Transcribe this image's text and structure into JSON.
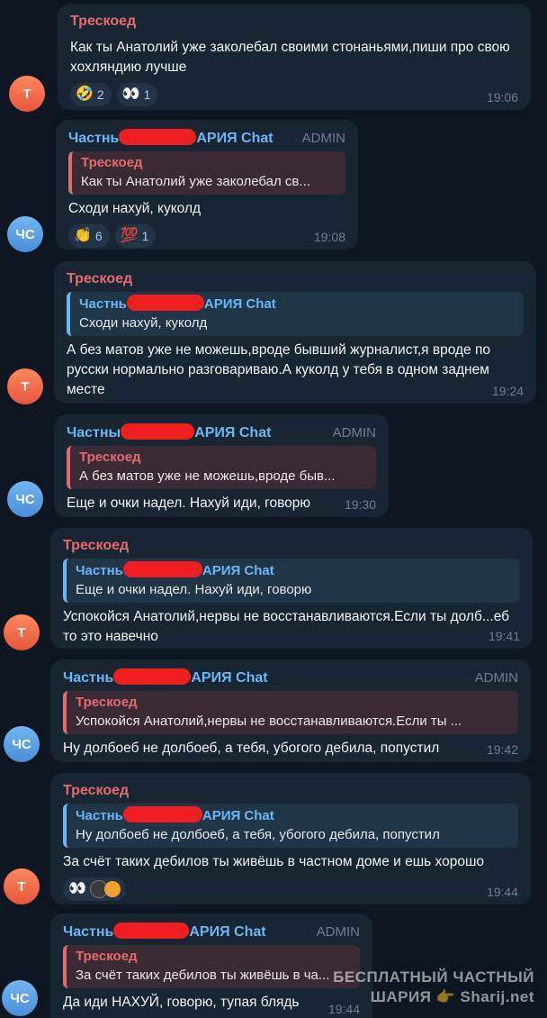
{
  "messages": [
    {
      "sender": "Трескоед",
      "text": "Как ты Анатолий уже заколебал своими стонаньями,пиши про свою хохляндию лучше",
      "time": "19:06",
      "reactions": [
        {
          "emoji": "🤣",
          "count": "2"
        },
        {
          "emoji": "👀",
          "count": "1"
        }
      ],
      "avatar": "Т"
    },
    {
      "sender_pre": "Частнь",
      "sender_post": "АРИЯ Chat",
      "admin": "ADMIN",
      "reply_name": "Трескоед",
      "reply_text": "Как ты Анатолий уже заколебал св...",
      "text": "Сходи нахуй, куколд",
      "time": "19:08",
      "reactions": [
        {
          "emoji": "👏",
          "count": "6"
        },
        {
          "emoji": "💯",
          "count": "1"
        }
      ],
      "avatar": "ЧС"
    },
    {
      "sender": "Трескоед",
      "reply_pre": "Частнь",
      "reply_post": "АРИЯ Chat",
      "reply_text": "Сходи нахуй, куколд",
      "text": "А без матов уже не можешь,вроде бывший журналист,я вроде по русски нормально разговариваю.А куколд у тебя в одном заднем  месте",
      "time": "19:24",
      "avatar": "Т"
    },
    {
      "sender_pre": "Частны",
      "sender_post": "АРИЯ Chat",
      "admin": "ADMIN",
      "reply_name": "Трескоед",
      "reply_text": "А без матов уже не можешь,вроде быв...",
      "text": "Еще и очки надел. Нахуй иди, говорю",
      "time": "19:30",
      "avatar": "ЧС"
    },
    {
      "sender": "Трескоед",
      "reply_pre": "Частнь",
      "reply_post": "АРИЯ Chat",
      "reply_text": "Еще и очки надел. Нахуй иди, говорю",
      "text": "Успокойся Анатолий,нервы не восстанавливаются.Если ты долб...еб то это навечно",
      "time": "19:41",
      "avatar": "Т"
    },
    {
      "sender_pre": "Частнь",
      "sender_post": "АРИЯ Chat",
      "admin": "ADMIN",
      "reply_name": "Трескоед",
      "reply_text": "Успокойся Анатолий,нервы не восстанавливаются.Если ты ...",
      "text": "Ну долбоеб не долбоеб, а тебя, убогого дебила, попустил",
      "time": "19:42",
      "avatar": "ЧС"
    },
    {
      "sender": "Трескоед",
      "reply_pre": "Частнь",
      "reply_post": "АРИЯ Chat",
      "reply_text": "Ну долбоеб не долбоеб, а тебя, убогого дебила, попустил",
      "text": "За счёт таких дебилов ты живёшь в частном доме и ешь хорошо",
      "time": "19:44",
      "reactions": [
        {
          "emoji": "👀",
          "count": ""
        }
      ],
      "avatar": "Т"
    },
    {
      "sender_pre": "Частнь",
      "sender_post": "АРИЯ Chat",
      "admin": "ADMIN",
      "reply_name": "Трескоед",
      "reply_text": "За счёт таких дебилов ты живёшь в ча...",
      "text": "Да иди НАХУЙ, говорю, тупая блядь",
      "time": "19:44",
      "avatar": "ЧС"
    }
  ],
  "watermark": {
    "line1": "БЕСПЛАТНЫЙ ЧАСТНЫЙ",
    "line2": "ШАРИЯ 👉 Sharij.net"
  }
}
